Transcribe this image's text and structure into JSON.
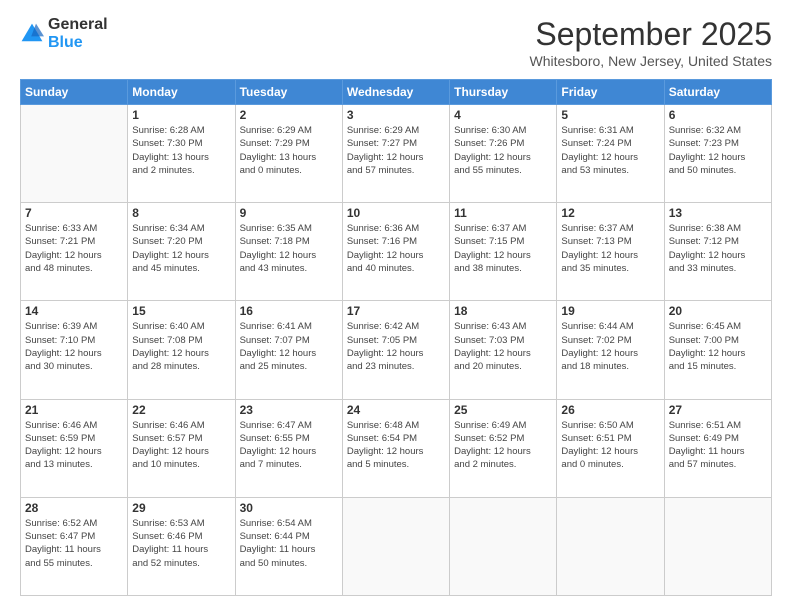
{
  "logo": {
    "general": "General",
    "blue": "Blue"
  },
  "header": {
    "month": "September 2025",
    "location": "Whitesboro, New Jersey, United States"
  },
  "weekdays": [
    "Sunday",
    "Monday",
    "Tuesday",
    "Wednesday",
    "Thursday",
    "Friday",
    "Saturday"
  ],
  "weeks": [
    [
      {
        "day": "",
        "info": ""
      },
      {
        "day": "1",
        "info": "Sunrise: 6:28 AM\nSunset: 7:30 PM\nDaylight: 13 hours\nand 2 minutes."
      },
      {
        "day": "2",
        "info": "Sunrise: 6:29 AM\nSunset: 7:29 PM\nDaylight: 13 hours\nand 0 minutes."
      },
      {
        "day": "3",
        "info": "Sunrise: 6:29 AM\nSunset: 7:27 PM\nDaylight: 12 hours\nand 57 minutes."
      },
      {
        "day": "4",
        "info": "Sunrise: 6:30 AM\nSunset: 7:26 PM\nDaylight: 12 hours\nand 55 minutes."
      },
      {
        "day": "5",
        "info": "Sunrise: 6:31 AM\nSunset: 7:24 PM\nDaylight: 12 hours\nand 53 minutes."
      },
      {
        "day": "6",
        "info": "Sunrise: 6:32 AM\nSunset: 7:23 PM\nDaylight: 12 hours\nand 50 minutes."
      }
    ],
    [
      {
        "day": "7",
        "info": "Sunrise: 6:33 AM\nSunset: 7:21 PM\nDaylight: 12 hours\nand 48 minutes."
      },
      {
        "day": "8",
        "info": "Sunrise: 6:34 AM\nSunset: 7:20 PM\nDaylight: 12 hours\nand 45 minutes."
      },
      {
        "day": "9",
        "info": "Sunrise: 6:35 AM\nSunset: 7:18 PM\nDaylight: 12 hours\nand 43 minutes."
      },
      {
        "day": "10",
        "info": "Sunrise: 6:36 AM\nSunset: 7:16 PM\nDaylight: 12 hours\nand 40 minutes."
      },
      {
        "day": "11",
        "info": "Sunrise: 6:37 AM\nSunset: 7:15 PM\nDaylight: 12 hours\nand 38 minutes."
      },
      {
        "day": "12",
        "info": "Sunrise: 6:37 AM\nSunset: 7:13 PM\nDaylight: 12 hours\nand 35 minutes."
      },
      {
        "day": "13",
        "info": "Sunrise: 6:38 AM\nSunset: 7:12 PM\nDaylight: 12 hours\nand 33 minutes."
      }
    ],
    [
      {
        "day": "14",
        "info": "Sunrise: 6:39 AM\nSunset: 7:10 PM\nDaylight: 12 hours\nand 30 minutes."
      },
      {
        "day": "15",
        "info": "Sunrise: 6:40 AM\nSunset: 7:08 PM\nDaylight: 12 hours\nand 28 minutes."
      },
      {
        "day": "16",
        "info": "Sunrise: 6:41 AM\nSunset: 7:07 PM\nDaylight: 12 hours\nand 25 minutes."
      },
      {
        "day": "17",
        "info": "Sunrise: 6:42 AM\nSunset: 7:05 PM\nDaylight: 12 hours\nand 23 minutes."
      },
      {
        "day": "18",
        "info": "Sunrise: 6:43 AM\nSunset: 7:03 PM\nDaylight: 12 hours\nand 20 minutes."
      },
      {
        "day": "19",
        "info": "Sunrise: 6:44 AM\nSunset: 7:02 PM\nDaylight: 12 hours\nand 18 minutes."
      },
      {
        "day": "20",
        "info": "Sunrise: 6:45 AM\nSunset: 7:00 PM\nDaylight: 12 hours\nand 15 minutes."
      }
    ],
    [
      {
        "day": "21",
        "info": "Sunrise: 6:46 AM\nSunset: 6:59 PM\nDaylight: 12 hours\nand 13 minutes."
      },
      {
        "day": "22",
        "info": "Sunrise: 6:46 AM\nSunset: 6:57 PM\nDaylight: 12 hours\nand 10 minutes."
      },
      {
        "day": "23",
        "info": "Sunrise: 6:47 AM\nSunset: 6:55 PM\nDaylight: 12 hours\nand 7 minutes."
      },
      {
        "day": "24",
        "info": "Sunrise: 6:48 AM\nSunset: 6:54 PM\nDaylight: 12 hours\nand 5 minutes."
      },
      {
        "day": "25",
        "info": "Sunrise: 6:49 AM\nSunset: 6:52 PM\nDaylight: 12 hours\nand 2 minutes."
      },
      {
        "day": "26",
        "info": "Sunrise: 6:50 AM\nSunset: 6:51 PM\nDaylight: 12 hours\nand 0 minutes."
      },
      {
        "day": "27",
        "info": "Sunrise: 6:51 AM\nSunset: 6:49 PM\nDaylight: 11 hours\nand 57 minutes."
      }
    ],
    [
      {
        "day": "28",
        "info": "Sunrise: 6:52 AM\nSunset: 6:47 PM\nDaylight: 11 hours\nand 55 minutes."
      },
      {
        "day": "29",
        "info": "Sunrise: 6:53 AM\nSunset: 6:46 PM\nDaylight: 11 hours\nand 52 minutes."
      },
      {
        "day": "30",
        "info": "Sunrise: 6:54 AM\nSunset: 6:44 PM\nDaylight: 11 hours\nand 50 minutes."
      },
      {
        "day": "",
        "info": ""
      },
      {
        "day": "",
        "info": ""
      },
      {
        "day": "",
        "info": ""
      },
      {
        "day": "",
        "info": ""
      }
    ]
  ]
}
